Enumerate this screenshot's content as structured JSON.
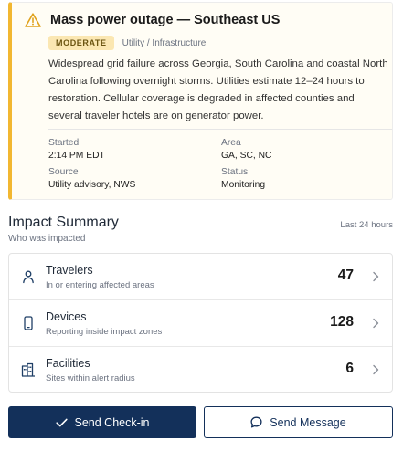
{
  "alert": {
    "title": "Mass power outage — Southeast US",
    "severity": "MODERATE",
    "category": "Utility / Infrastructure",
    "description": "Widespread grid failure across Georgia, South Carolina and coastal North Carolina following overnight storms. Utilities estimate 12–24 hours to restoration. Cellular coverage is degraded in affected counties and several traveler hotels are on generator power.",
    "started_label": "Started",
    "started_value": "2:14 PM EDT",
    "area_label": "Area",
    "area_value": "GA, SC, NC",
    "source_label": "Source",
    "source_value": "Utility advisory, NWS",
    "status_label": "Status",
    "status_value": "Monitoring",
    "accent_color": "#f2b731"
  },
  "impact": {
    "title": "Impact Summary",
    "subtitle": "Who was impacted",
    "timeframe": "Last 24 hours",
    "rows": [
      {
        "icon": "person-icon",
        "title": "Travelers",
        "subtitle": "In or entering affected areas",
        "count": "47"
      },
      {
        "icon": "phone-icon",
        "title": "Devices",
        "subtitle": "Reporting inside impact zones",
        "count": "128"
      },
      {
        "icon": "building-icon",
        "title": "Facilities",
        "subtitle": "Sites within alert radius",
        "count": "6"
      }
    ]
  },
  "actions": {
    "checkin_label": "Send Check-in",
    "message_label": "Send Message",
    "primary_color": "#13305a"
  }
}
